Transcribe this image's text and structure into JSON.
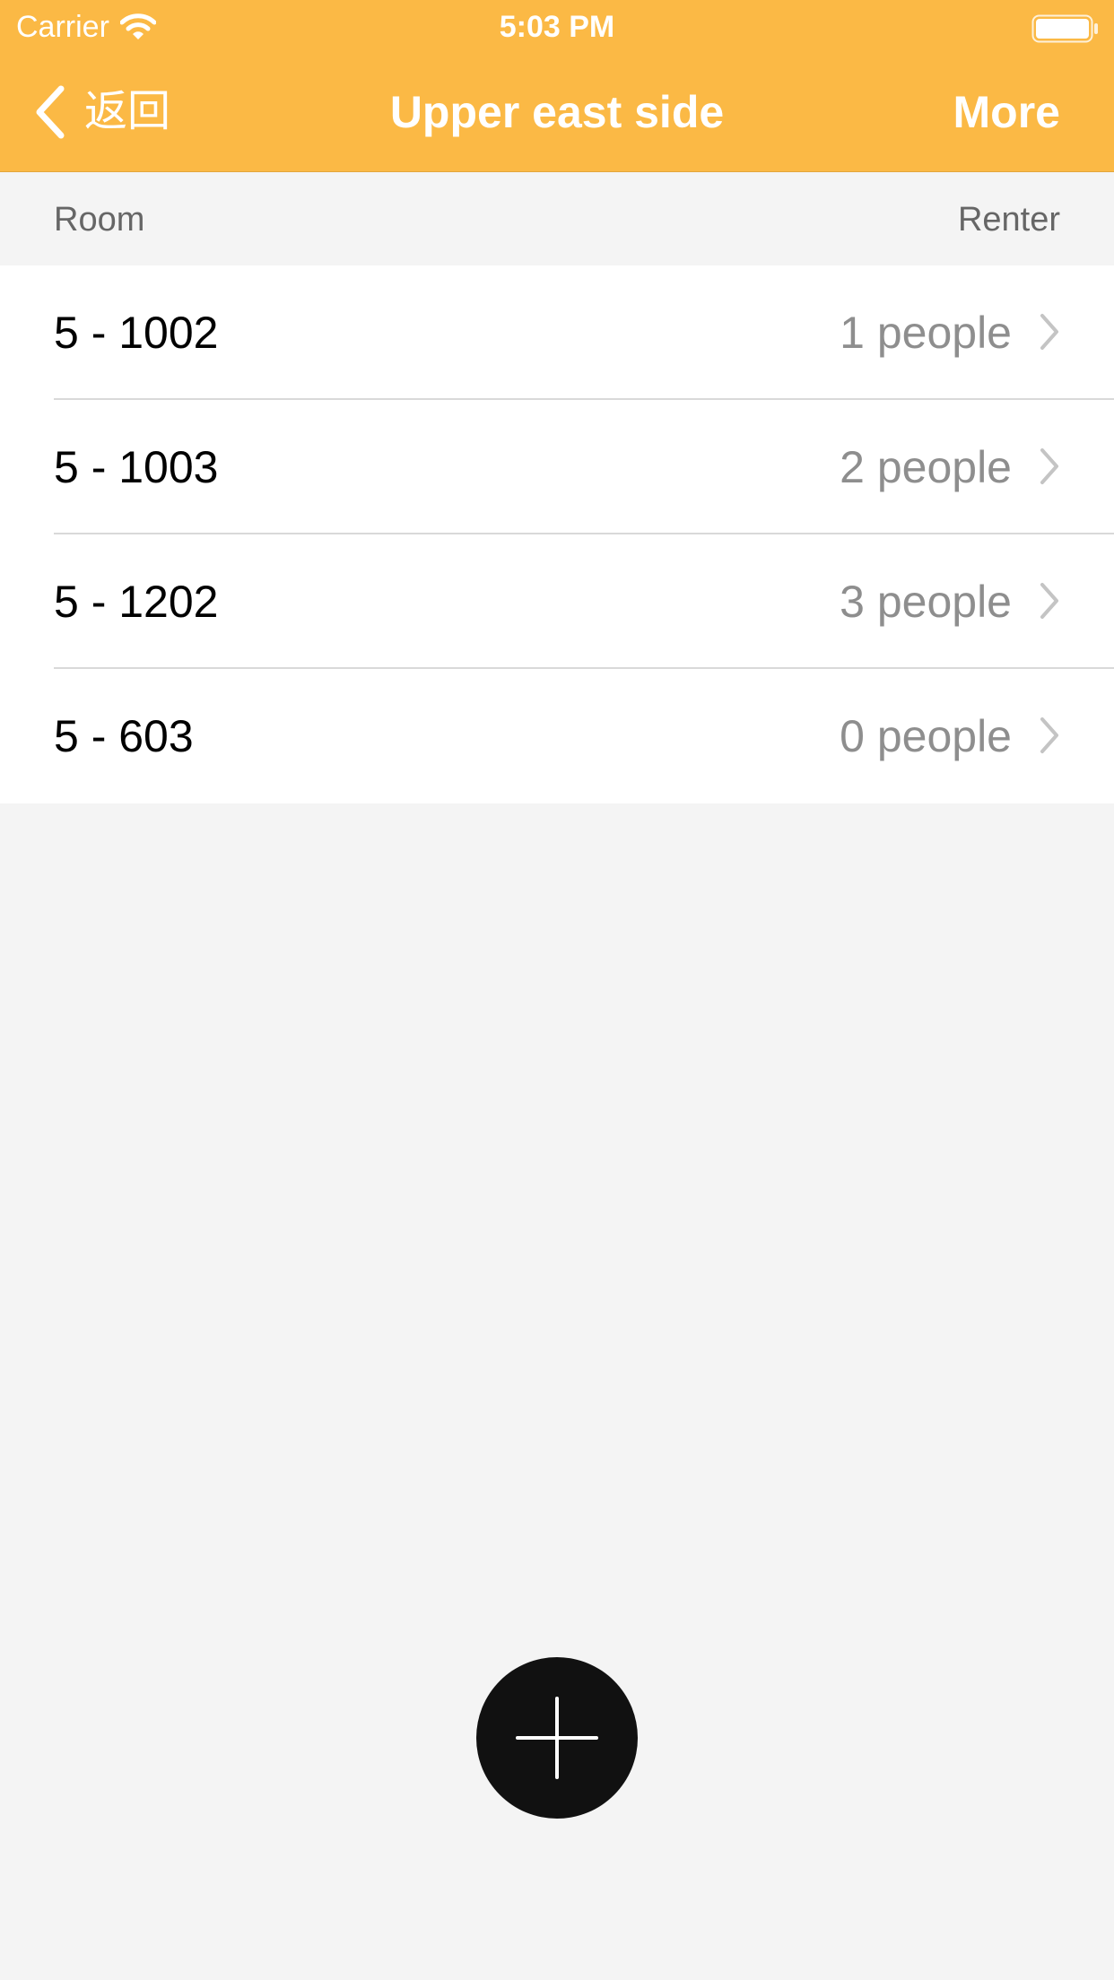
{
  "status_bar": {
    "carrier": "Carrier",
    "time": "5:03 PM",
    "wifi_icon": "wifi-icon",
    "battery_icon": "battery-icon"
  },
  "nav": {
    "back_label": "返回",
    "back_icon": "chevron-left-icon",
    "title": "Upper east side",
    "more_label": "More"
  },
  "columns": {
    "room": "Room",
    "renter": "Renter"
  },
  "rooms": [
    {
      "name": "5 - 1002",
      "renters": "1 people"
    },
    {
      "name": "5 - 1003",
      "renters": "2 people"
    },
    {
      "name": "5 - 1202",
      "renters": "3 people"
    },
    {
      "name": "5 - 603",
      "renters": "0 people"
    }
  ],
  "add_button": {
    "icon": "plus-icon"
  },
  "colors": {
    "accent": "#FBB945",
    "background": "#F4F4F4",
    "fab": "#111111",
    "secondary_text": "#8E8E8E"
  }
}
